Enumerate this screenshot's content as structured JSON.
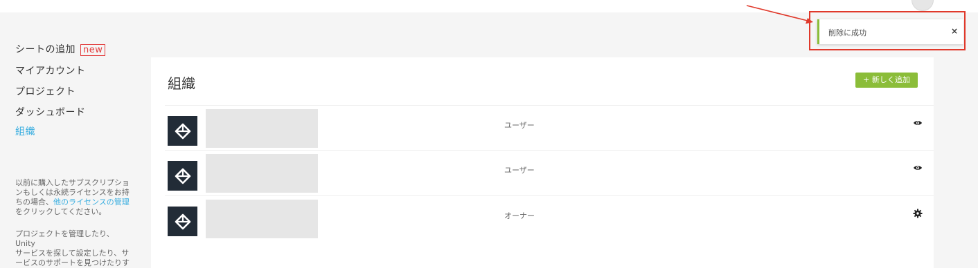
{
  "sidebar": {
    "add_seats": {
      "label": "シートの追加",
      "badge": "new"
    },
    "items": [
      {
        "label": "マイアカウント",
        "active": false
      },
      {
        "label": "プロジェクト",
        "active": false
      },
      {
        "label": "ダッシュボード",
        "active": false
      },
      {
        "label": "組織",
        "active": true
      }
    ],
    "note1": {
      "line1": "以前に購入したサブスクリプショ",
      "line2": "ンもしくは永続ライセンスをお持",
      "line3_prefix": "ちの場合、",
      "line3_link": "他のライセンスの管理",
      "line4": "をクリックしてください。"
    },
    "note2": {
      "line1": "プロジェクトを管理したり、Unity",
      "line2": "サービスを探して設定したり、サ",
      "line3": "ービスのサポートを見つけたりす"
    }
  },
  "main": {
    "title": "組織",
    "add_button": "+ 新しく追加",
    "rows": [
      {
        "role": "ユーザー",
        "action_icon": "eye-icon"
      },
      {
        "role": "ユーザー",
        "action_icon": "eye-icon"
      },
      {
        "role": "オーナー",
        "action_icon": "gear-icon"
      }
    ]
  },
  "toast": {
    "message": "削除に成功",
    "close": "×"
  },
  "colors": {
    "accent_green": "#8bbd39",
    "link_blue": "#3aaee0",
    "annotation_red": "#e0392b",
    "unity_dark": "#222c37"
  }
}
